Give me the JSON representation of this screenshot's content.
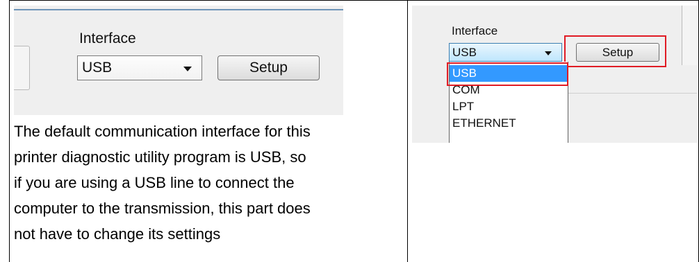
{
  "left_screenshot": {
    "interface_label": "Interface",
    "combo_value": "USB",
    "setup_label": "Setup"
  },
  "right_screenshot": {
    "interface_label": "Interface",
    "combo_value": "USB",
    "setup_label": "Setup",
    "options": [
      "USB",
      "COM",
      "LPT",
      "ETHERNET"
    ],
    "selected_option": "USB",
    "highlight_color": "#e01b24",
    "selection_color": "#3399ff"
  },
  "description": {
    "lines": [
      "The default communication interface for this",
      "printer diagnostic utility program is USB, so",
      "if you are using a USB line to connect the",
      "computer to the transmission, this part does",
      "not have to change its settings"
    ]
  }
}
